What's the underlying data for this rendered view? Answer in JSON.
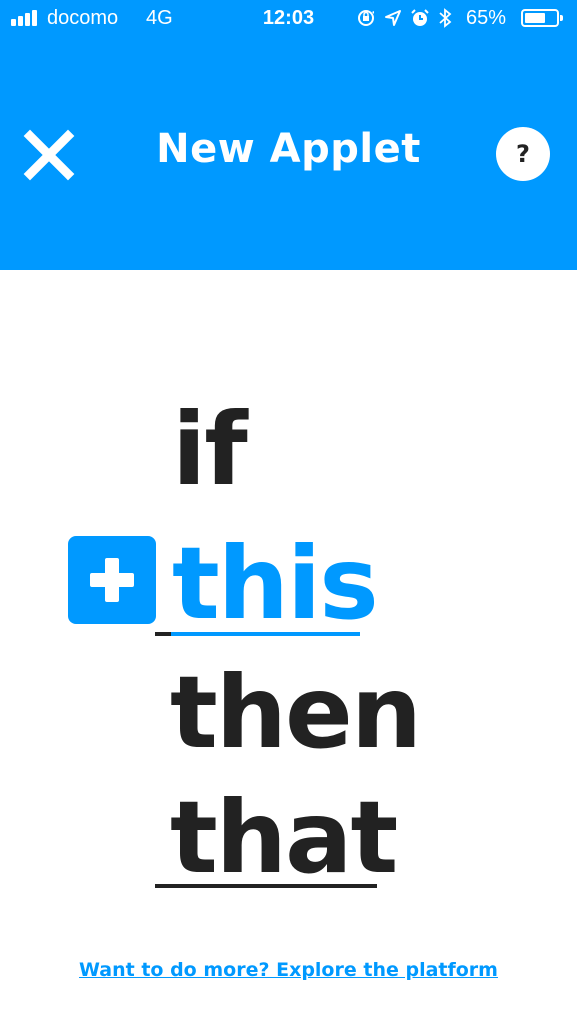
{
  "status_bar": {
    "carrier": "docomo",
    "network": "4G",
    "time": "12:03",
    "battery_percent": "65%",
    "battery_level": 0.65,
    "icons": [
      "signal-icon",
      "orientation-lock-icon",
      "location-icon",
      "alarm-icon",
      "bluetooth-icon",
      "battery-icon"
    ]
  },
  "nav": {
    "title": "New Applet",
    "close_icon": "close-icon",
    "help_label": "?"
  },
  "recipe": {
    "if": "if",
    "this": "this",
    "then": "then",
    "that": "that",
    "add_icon": "plus-icon"
  },
  "footer": {
    "link": "Want to do more? Explore the platform"
  },
  "colors": {
    "accent": "#0099ff",
    "text": "#222222",
    "background": "#ffffff"
  }
}
